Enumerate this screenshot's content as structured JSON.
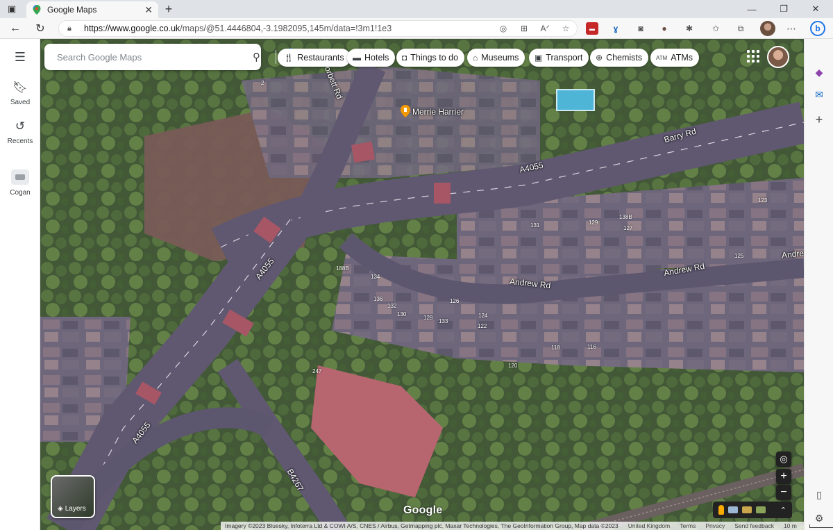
{
  "browser": {
    "tab_title": "Google Maps",
    "url_host": "https://www.google.co.uk",
    "url_path": "/maps/@51.4446804,-3.1982095,145m/data=!3m1!1e3"
  },
  "rail": {
    "menu_icon": "menu-icon",
    "items": [
      {
        "label": "Saved",
        "icon": "bookmark-icon"
      },
      {
        "label": "Recents",
        "icon": "history-icon"
      },
      {
        "label": "Cogan",
        "icon": "place-thumbnail"
      }
    ]
  },
  "search": {
    "placeholder": "Search Google Maps"
  },
  "chips": [
    {
      "label": "Restaurants",
      "icon": "restaurant-icon"
    },
    {
      "label": "Hotels",
      "icon": "hotel-icon"
    },
    {
      "label": "Things to do",
      "icon": "camera-icon"
    },
    {
      "label": "Museums",
      "icon": "museum-icon"
    },
    {
      "label": "Transport",
      "icon": "bus-icon"
    },
    {
      "label": "Chemists",
      "icon": "pharmacy-icon"
    },
    {
      "label": "ATMs",
      "icon": "atm-icon"
    }
  ],
  "map": {
    "roads": {
      "corbett": "Corbett Rd",
      "barry": "Barry Rd",
      "a4055_top": "A4055",
      "a4055_mid": "A4055",
      "a4055_bottom": "A4055",
      "andrew_1": "Andrew Rd",
      "andrew_2": "Andrew Rd",
      "andrew_3": "Andre",
      "b4267": "B4267"
    },
    "poi": "Merrie Harrier",
    "house_numbers": {
      "n2": "2",
      "n131": "131",
      "n129": "129",
      "n127": "127",
      "n123": "123",
      "n125": "125",
      "n138b": "138B",
      "n134": "134",
      "n136": "136",
      "n132": "132",
      "n130": "130",
      "n128": "128",
      "n133": "133",
      "n126": "126",
      "n124": "124",
      "n122": "122",
      "n118": "118",
      "n116": "116",
      "n120": "120",
      "n247": "247",
      "n188b": "188B"
    },
    "layers_label": "Layers",
    "logo": "Google",
    "attribution": "Imagery ©2023 Bluesky, Infoterra Ltd & COWI A/S, CNES / Airbus, Getmapping plc, Maxar Technologies, The GeoInformation Group, Map data ©2023",
    "footer_links": [
      "United Kingdom",
      "Terms",
      "Privacy",
      "Send feedback"
    ],
    "scale": "10 m"
  }
}
